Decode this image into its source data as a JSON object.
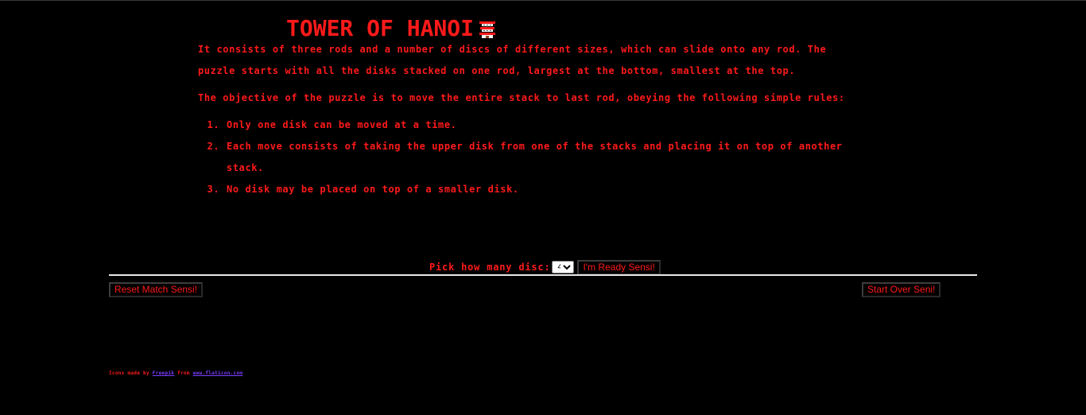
{
  "header": {
    "title": "TOWER OF HANOI",
    "icon": "hanoi-tower-icon"
  },
  "intro": {
    "paragraph1": "It consists of three rods and a number of discs of different sizes, which can slide onto any rod. The puzzle starts with all the disks stacked on one rod, largest at the bottom, smallest at the top.",
    "paragraph2": "The objective of the puzzle is to move the entire stack to last rod, obeying the following simple rules:",
    "rules": [
      "Only one disk can be moved at a time.",
      "Each move consists of taking the upper disk from one of the stacks and placing it on top of another stack.",
      "No disk may be placed on top of a smaller disk."
    ]
  },
  "picker": {
    "label": "Pick how many disc:",
    "selected": "4",
    "ready_label": "I'm Ready Sensi!"
  },
  "controls": {
    "reset_label": "Reset Match Sensi!",
    "start_over_label": "Start Over Seni!"
  },
  "credits": {
    "prefix": "Icons made by",
    "author": "Freepik",
    "middle": "from",
    "site": "www.flaticon.com"
  },
  "colors": {
    "background": "#000000",
    "text": "#ff1a1a",
    "link": "#7a3cff",
    "divider": "#e8e8e8"
  }
}
